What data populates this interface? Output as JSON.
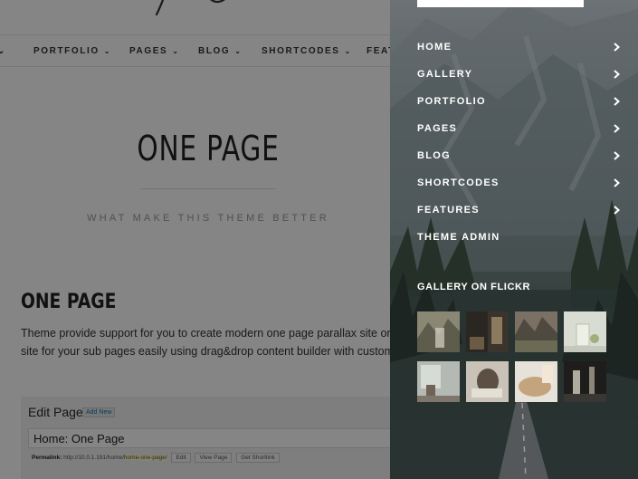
{
  "colors": {
    "panel_text": "#ffffff",
    "page_text": "#222222",
    "wp_link": "#0073aa"
  },
  "page": {
    "nav": [
      {
        "label": "PORTFOLIO"
      },
      {
        "label": "PAGES"
      },
      {
        "label": "BLOG"
      },
      {
        "label": "SHORTCODES"
      },
      {
        "label": "FEAT"
      }
    ],
    "hero_title": "ONE PAGE",
    "hero_subtitle": "WHAT MAKE THIS THEME BETTER",
    "section_title": "ONE PAGE",
    "section_text_1": "Theme provide support for you to create modern one page parallax site or m",
    "section_text_2": "site for your sub pages easily using drag&drop content builder with custom m",
    "editor": {
      "heading": "Edit Page",
      "add_new": "Add New",
      "title_value": "Home: One Page",
      "permalink_label": "Permalink:",
      "permalink_base": "http://10.0.1.191/home/",
      "permalink_slug": "home-one-page/",
      "edit_btn": "Edit",
      "view_btn": "View Page",
      "shortlink_btn": "Get Shortlink"
    }
  },
  "panel": {
    "menu": [
      {
        "label": "HOME",
        "has_submenu": true
      },
      {
        "label": "GALLERY",
        "has_submenu": true
      },
      {
        "label": "PORTFOLIO",
        "has_submenu": true
      },
      {
        "label": "PAGES",
        "has_submenu": true
      },
      {
        "label": "BLOG",
        "has_submenu": true
      },
      {
        "label": "SHORTCODES",
        "has_submenu": true
      },
      {
        "label": "FEATURES",
        "has_submenu": true
      },
      {
        "label": "THEME ADMIN",
        "has_submenu": false
      }
    ],
    "widget_title": "GALLERY ON FLICKR",
    "flickr_thumbs": [
      {
        "name": "flickr-photo-1",
        "bg": "#8a8775",
        "accent": "#c9c7b8"
      },
      {
        "name": "flickr-photo-2",
        "bg": "#2a2622",
        "accent": "#8c7a5e"
      },
      {
        "name": "flickr-photo-3",
        "bg": "#7a7164",
        "accent": "#4f4a40"
      },
      {
        "name": "flickr-photo-4",
        "bg": "#d9dcd2",
        "accent": "#9fae7c"
      },
      {
        "name": "flickr-photo-5",
        "bg": "#b5b9b4",
        "accent": "#6e6456"
      },
      {
        "name": "flickr-photo-6",
        "bg": "#c8c2b7",
        "accent": "#5c5045"
      },
      {
        "name": "flickr-photo-7",
        "bg": "#e6e2da",
        "accent": "#c4a47c"
      },
      {
        "name": "flickr-photo-8",
        "bg": "#1f1d1b",
        "accent": "#c9c4b4"
      }
    ]
  }
}
